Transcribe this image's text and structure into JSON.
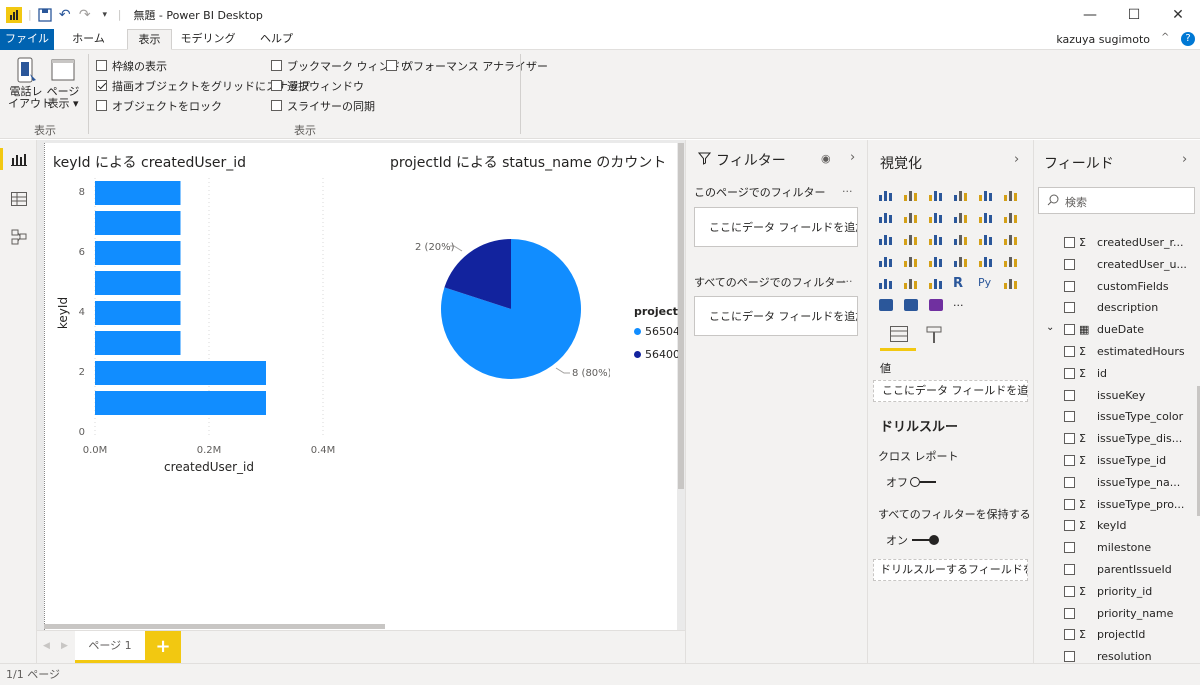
{
  "titlebar": {
    "app_title": "無題 - Power BI Desktop",
    "minimize": "—",
    "maximize": "☐",
    "close": "✕"
  },
  "menu": {
    "tabs": [
      "ファイル",
      "ホーム",
      "表示",
      "モデリング",
      "ヘルプ"
    ],
    "active": "表示",
    "user": "kazuya sugimoto"
  },
  "ribbon": {
    "phone_layout": [
      "電話レ",
      "イアウト"
    ],
    "page_view": [
      "ページ",
      "表示 ▾"
    ],
    "group1_label": "表示",
    "group2_label": "表示",
    "checkboxes": [
      {
        "label": "枠線の表示",
        "checked": false
      },
      {
        "label": "描画オブジェクトをグリッドにスナップ",
        "checked": true
      },
      {
        "label": "オブジェクトをロック",
        "checked": false
      },
      {
        "label": "ブックマーク ウィンドウ",
        "checked": false
      },
      {
        "label": "選択ウィンドウ",
        "checked": false
      },
      {
        "label": "スライサーの同期",
        "checked": false
      },
      {
        "label": "パフォーマンス アナライザー",
        "checked": false
      }
    ]
  },
  "visual1": {
    "title": "keyId による createdUser_id"
  },
  "visual2": {
    "title": "projectId による status_name のカウント",
    "legend_title": "projectI",
    "legend": [
      "56504",
      "56400"
    ]
  },
  "chart_data": [
    {
      "type": "bar",
      "title": "keyId による createdUser_id",
      "xlabel": "createdUser_id",
      "ylabel": "keyId",
      "categories": [
        8,
        7,
        6,
        5,
        4,
        3,
        2,
        1
      ],
      "values": [
        150000,
        150000,
        150000,
        150000,
        150000,
        150000,
        300000,
        300000
      ],
      "x_ticks": [
        "0.0M",
        "0.2M",
        "0.4M"
      ],
      "y_ticks": [
        "8",
        "6",
        "4",
        "2",
        "0"
      ],
      "xlim": [
        0,
        0.4
      ],
      "ylim": [
        0,
        8
      ],
      "color": "#118dff"
    },
    {
      "type": "pie",
      "title": "projectId による status_name のカウント",
      "slices": [
        {
          "name": "56504",
          "value": 8,
          "label": "8 (80%)",
          "color": "#118dff"
        },
        {
          "name": "56400",
          "value": 2,
          "label": "2 (20%)",
          "color": "#12239e"
        }
      ]
    }
  ],
  "pagebar": {
    "page_tab": "ページ 1",
    "add": "+"
  },
  "status": "1/1 ページ",
  "filters": {
    "title": "フィルター",
    "this_page": "このページでのフィルター",
    "all_pages": "すべてのページでのフィルター",
    "drop1": "ここにデータ フィールドを追加し...",
    "drop2": "ここにデータ フィールドを追加し...",
    "more": "..."
  },
  "viz": {
    "title": "視覚化",
    "values_label": "値",
    "values_drop": "ここにデータ フィールドを追加して...",
    "drill_title": "ドリルスルー",
    "cross_report": "クロス レポート",
    "off": "オフ",
    "keep_filters": "すべてのフィルターを保持する",
    "on": "オン",
    "drill_drop": "ドリルスルーするフィールドをここ...",
    "more": "...",
    "r_icon": "R",
    "py_icon": "Py"
  },
  "fields": {
    "title": "フィールド",
    "search_placeholder": "検索",
    "items": [
      {
        "label": "createdUser_r...",
        "sigma": true
      },
      {
        "label": "createdUser_u...",
        "sigma": false
      },
      {
        "label": "customFields",
        "sigma": false
      },
      {
        "label": "description",
        "sigma": false
      },
      {
        "label": "dueDate",
        "sigma": false,
        "calendar": true,
        "expand": true
      },
      {
        "label": "estimatedHours",
        "sigma": true
      },
      {
        "label": "id",
        "sigma": true
      },
      {
        "label": "issueKey",
        "sigma": false
      },
      {
        "label": "issueType_color",
        "sigma": false
      },
      {
        "label": "issueType_dis...",
        "sigma": true
      },
      {
        "label": "issueType_id",
        "sigma": true
      },
      {
        "label": "issueType_na...",
        "sigma": false
      },
      {
        "label": "issueType_pro...",
        "sigma": true
      },
      {
        "label": "keyId",
        "sigma": true
      },
      {
        "label": "milestone",
        "sigma": false
      },
      {
        "label": "parentIssueId",
        "sigma": false
      },
      {
        "label": "priority_id",
        "sigma": true
      },
      {
        "label": "priority_name",
        "sigma": false
      },
      {
        "label": "projectId",
        "sigma": true
      },
      {
        "label": "resolution",
        "sigma": false
      }
    ]
  }
}
